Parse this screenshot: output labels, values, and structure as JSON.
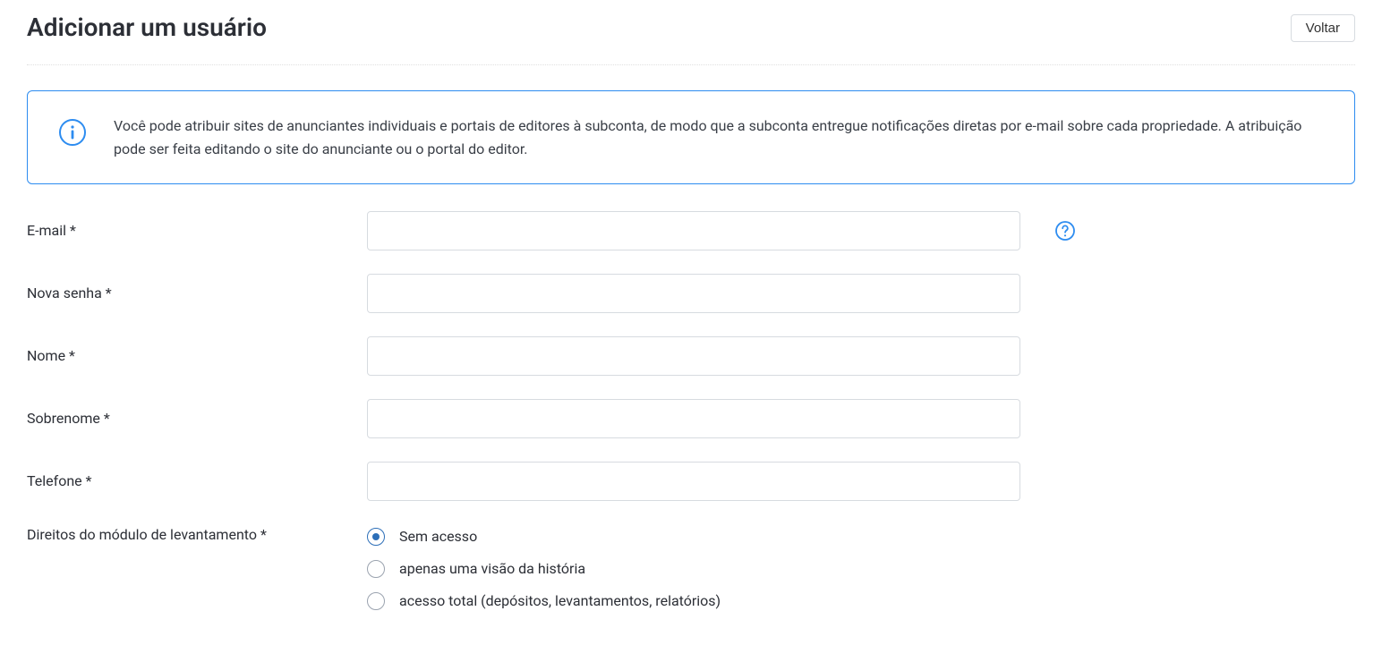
{
  "header": {
    "title": "Adicionar um usuário",
    "back_label": "Voltar"
  },
  "info": {
    "text": "Você pode atribuir sites de anunciantes individuais e portais de editores à subconta, de modo que a subconta entregue notificações diretas por e-mail sobre cada propriedade. A atribuição pode ser feita editando o site do anunciante ou o portal do editor."
  },
  "form": {
    "email": {
      "label": "E-mail *",
      "value": ""
    },
    "password": {
      "label": "Nova senha *",
      "value": ""
    },
    "firstname": {
      "label": "Nome *",
      "value": ""
    },
    "lastname": {
      "label": "Sobrenome *",
      "value": ""
    },
    "phone": {
      "label": "Telefone *",
      "value": ""
    },
    "rights": {
      "label": "Direitos do módulo de levantamento *",
      "options": [
        {
          "label": "Sem acesso",
          "selected": true
        },
        {
          "label": "apenas uma visão da história",
          "selected": false
        },
        {
          "label": "acesso total (depósitos, levantamentos, relatórios)",
          "selected": false
        }
      ]
    }
  }
}
